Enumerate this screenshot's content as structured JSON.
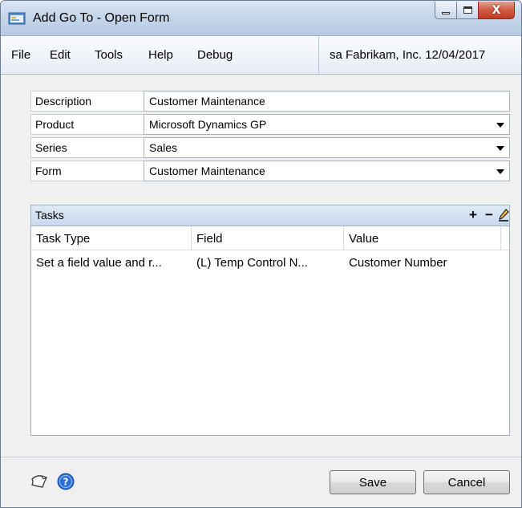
{
  "window": {
    "title": "Add Go To - Open Form",
    "minimize_symbol": "",
    "close_symbol": "X"
  },
  "menu": {
    "items": [
      "File",
      "Edit",
      "Tools",
      "Help",
      "Debug"
    ],
    "status": "sa  Fabrikam, Inc. 12/04/2017"
  },
  "fields": {
    "description": {
      "label": "Description",
      "value": "Customer Maintenance"
    },
    "product": {
      "label": "Product",
      "value": "Microsoft Dynamics GP"
    },
    "series": {
      "label": "Series",
      "value": "Sales"
    },
    "form": {
      "label": "Form",
      "value": "Customer Maintenance"
    }
  },
  "tasks": {
    "title": "Tasks",
    "add_symbol": "+",
    "remove_symbol": "−",
    "columns": [
      "Task Type",
      "Field",
      "Value"
    ],
    "rows": [
      {
        "task_type": "Set a field value and r...",
        "field": "(L) Temp Control N...",
        "value": "Customer Number"
      }
    ]
  },
  "footer": {
    "save_label": "Save",
    "cancel_label": "Cancel"
  },
  "colors": {
    "titlebar": "#c6d6ea",
    "close_button": "#c43b22",
    "panel_header": "#c9daee",
    "help_icon": "#2a6fd6"
  },
  "icons": {
    "app": "form-app-icon",
    "edit": "pencil-icon",
    "note": "note-icon",
    "help": "help-icon"
  }
}
